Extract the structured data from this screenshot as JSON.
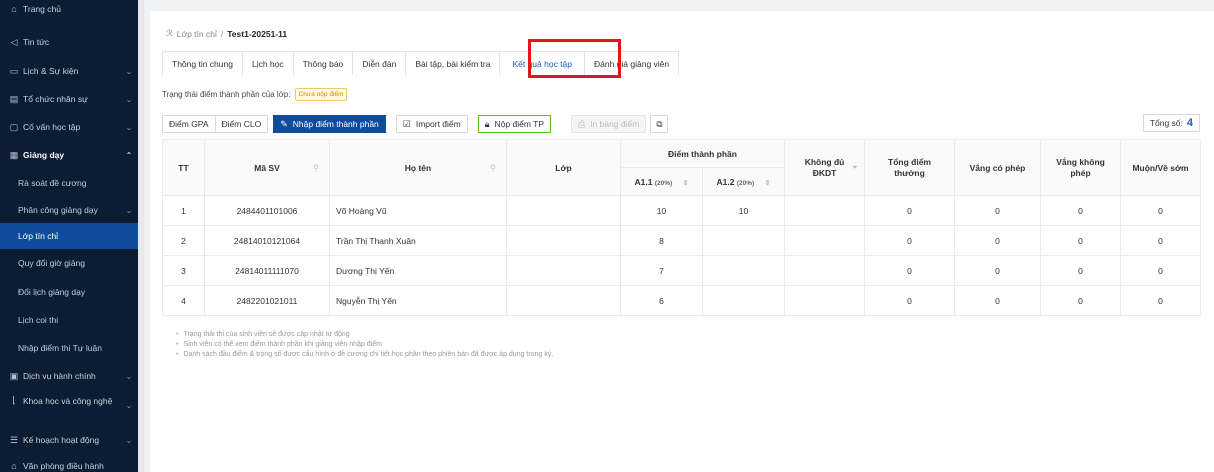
{
  "sidebar": {
    "items": [
      {
        "icon": "⌂",
        "label": "Trang chủ",
        "chevron": ""
      },
      {
        "icon": "◁",
        "label": "Tin tức",
        "chevron": ""
      },
      {
        "icon": "▭",
        "label": "Lịch & Sự kiện",
        "chevron": "⌄"
      },
      {
        "icon": "▤",
        "label": "Tổ chức nhân sự",
        "chevron": "⌄"
      },
      {
        "icon": "▢",
        "label": "Cố vấn học tập",
        "chevron": "⌄"
      },
      {
        "icon": "▦",
        "label": "Giảng dạy",
        "chevron": "⌃"
      },
      {
        "label": "Rà soát đề cương"
      },
      {
        "label": "Phân công giảng dạy",
        "chevron": "⌄"
      },
      {
        "label": "Lớp tín chỉ"
      },
      {
        "label": "Quy đổi giờ giảng"
      },
      {
        "label": "Đổi lịch giảng dạy"
      },
      {
        "label": "Lịch coi thi"
      },
      {
        "label": "Nhập điểm thi Tự luận"
      },
      {
        "icon": "▣",
        "label": "Dịch vụ hành chính",
        "chevron": "⌄"
      },
      {
        "icon": "⌊",
        "label": "Khoa học và công nghệ",
        "chevron": "⌄"
      },
      {
        "icon": "☰",
        "label": "Kế hoạch hoạt động",
        "chevron": "⌄"
      },
      {
        "icon": "⌂",
        "label": "Văn phòng điều hành",
        "chevron": ""
      }
    ]
  },
  "breadcrumb": {
    "icon": "ℛ",
    "parent": "Lớp tín chỉ",
    "separator": "/",
    "current": "Test1-20251-11"
  },
  "tabs": [
    "Thông tin chung",
    "Lịch học",
    "Thông báo",
    "Diễn đàn",
    "Bài tập, bài kiểm tra",
    "Kết quả học tập",
    "Đánh giá giảng viên"
  ],
  "status": {
    "label": "Trạng thái điểm thành phần của lớp:",
    "badge": "Chưa nộp điểm"
  },
  "toolbar": {
    "gpa": "Điểm GPA",
    "clo": "Điểm CLO",
    "enter": "Nhập điểm thành phần",
    "import": "Import điểm",
    "submit": "Nộp điểm TP",
    "print": "In bảng điểm"
  },
  "total": {
    "label": "Tổng số:",
    "value": "4"
  },
  "table": {
    "headers": {
      "tt": "TT",
      "masv": "Mã SV",
      "hoten": "Họ tên",
      "lop": "Lớp",
      "group": "Điểm thành phần",
      "a11": "A1.1",
      "a11_pct": "(20%)",
      "a12": "A1.2",
      "a12_pct": "(20%)",
      "khongdu": "Không đủ ĐKDT",
      "tongdiem": "Tổng điểm thưởng",
      "vangcophep": "Vắng có phép",
      "vangkhongphep": "Vắng không phép",
      "muon": "Muộn/Về sớm"
    },
    "rows": [
      {
        "tt": "1",
        "masv": "2484401101006",
        "hoten": "Võ Hoàng Vũ",
        "lop": "",
        "a11": "10",
        "a12": "10",
        "khongdu": "",
        "tongdiem": "0",
        "vangcophep": "0",
        "vangkhongphep": "0",
        "muon": "0"
      },
      {
        "tt": "2",
        "masv": "24814010121064",
        "hoten": "Trần Thị Thanh Xuân",
        "lop": "",
        "a11": "8",
        "a12": "",
        "khongdu": "",
        "tongdiem": "0",
        "vangcophep": "0",
        "vangkhongphep": "0",
        "muon": "0"
      },
      {
        "tt": "3",
        "masv": "24814011111070",
        "hoten": "Dương Thị Yến",
        "lop": "",
        "a11": "7",
        "a12": "",
        "khongdu": "",
        "tongdiem": "0",
        "vangcophep": "0",
        "vangkhongphep": "0",
        "muon": "0"
      },
      {
        "tt": "4",
        "masv": "2482201021011",
        "hoten": "Nguyễn Thị Yến",
        "lop": "",
        "a11": "6",
        "a12": "",
        "khongdu": "",
        "tongdiem": "0",
        "vangcophep": "0",
        "vangkhongphep": "0",
        "muon": "0"
      }
    ]
  },
  "notes": [
    "Trạng thái thi của sinh viên sẽ được cập nhật tự động",
    "Sinh viên có thể xem điểm thành phần khi giảng viên nhập điểm",
    "Danh sách đầu điểm & trọng số được cấu hình ở đề cương chi tiết học phần theo phiên bản đã được áp dụng trong kỳ."
  ]
}
